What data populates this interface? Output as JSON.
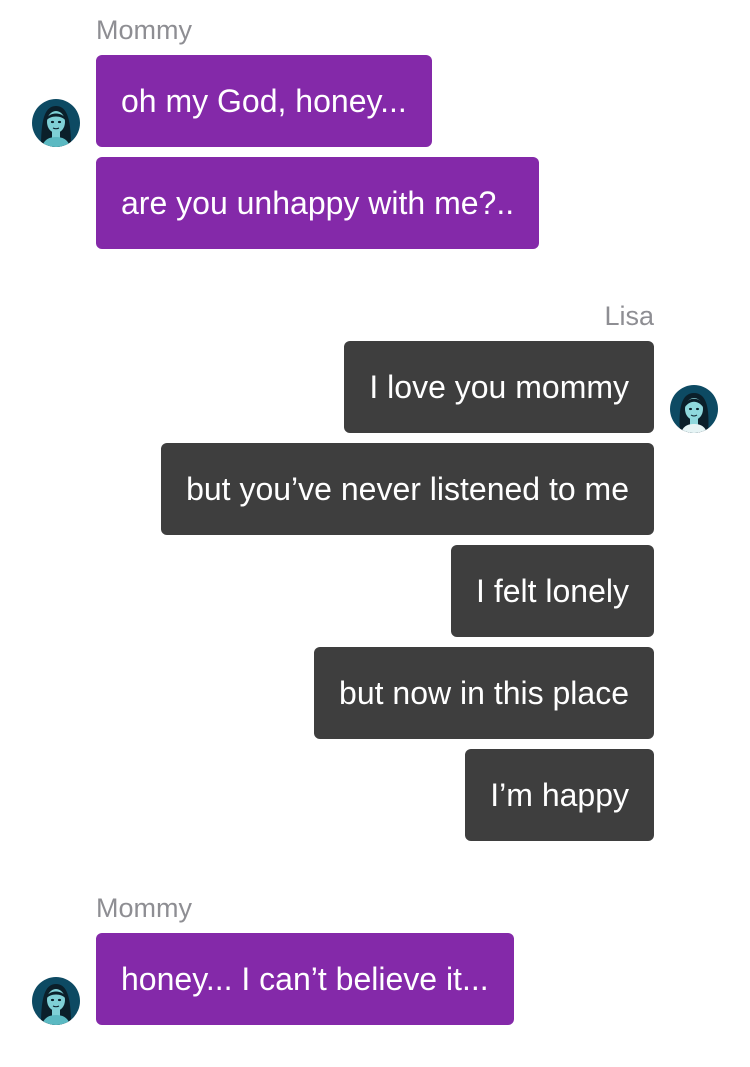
{
  "colors": {
    "incoming_bubble": "#8429a9",
    "outgoing_bubble": "#3e3e3e",
    "sender_name": "#8e8e93",
    "avatar_bg": "#0d4a63"
  },
  "icons": {
    "mommy_avatar": "mommy-avatar-icon",
    "lisa_avatar": "lisa-avatar-icon"
  },
  "groups": [
    {
      "sender": "Mommy",
      "messages": [
        "oh my God, honey...",
        "are you unhappy with me?.."
      ]
    },
    {
      "sender": "Lisa",
      "messages": [
        "I love you mommy",
        "but you’ve never listened to me",
        "I felt lonely",
        "but now in this place",
        "I’m happy"
      ]
    },
    {
      "sender": "Mommy",
      "messages": [
        "honey... I can’t believe it..."
      ]
    }
  ]
}
